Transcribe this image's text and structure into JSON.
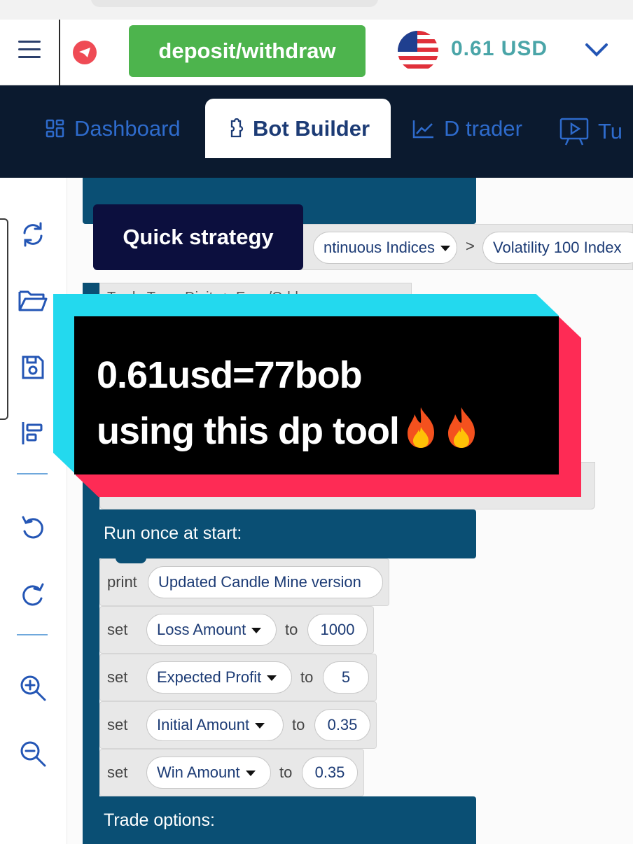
{
  "header": {
    "deposit_label": "deposit/withdraw",
    "balance": "0.61 USD",
    "currency_flag": "us-flag-icon"
  },
  "nav": {
    "tabs": [
      {
        "label": "Dashboard",
        "icon": "dashboard-icon",
        "active": false
      },
      {
        "label": "Bot Builder",
        "icon": "puzzle-icon",
        "active": true
      },
      {
        "label": "D trader",
        "icon": "chart-line-icon",
        "active": false
      },
      {
        "label": "Tu",
        "icon": "tutorial-icon",
        "active": false
      }
    ]
  },
  "toolbar": {
    "icons": [
      "reset-icon",
      "open-folder-icon",
      "save-icon",
      "align-icon",
      "undo-icon",
      "redo-icon",
      "zoom-in-icon",
      "zoom-out-icon"
    ]
  },
  "workspace": {
    "quick_strategy_label": "Quick strategy",
    "market_dropdown": "ntinuous Indices",
    "market_separator": ">",
    "symbol_dropdown": "Volatility 100 Index",
    "trade_type_row": "Trade Type: Digits > Even/Odd",
    "run_once_label": "Run once at start:",
    "print_keyword": "print",
    "print_value": "Updated Candle Mine version",
    "set_keyword": "set",
    "to_keyword": "to",
    "variables": [
      {
        "name": "Loss Amount",
        "value": "1000"
      },
      {
        "name": "Expected Profit",
        "value": "5"
      },
      {
        "name": "Initial Amount",
        "value": "0.35"
      },
      {
        "name": "Win Amount",
        "value": "0.35"
      }
    ],
    "trade_options_label": "Trade options:"
  },
  "overlay": {
    "line1": "0.61usd=77bob",
    "line2": "using this dp tool"
  },
  "colors": {
    "block_blue": "#0a4f74",
    "nav_bg": "#0b1a2f",
    "deposit_green": "#4db44d",
    "balance_teal": "#4aa5a8",
    "overlay_cyan": "#23d9ee",
    "overlay_pink": "#fe2b55"
  }
}
